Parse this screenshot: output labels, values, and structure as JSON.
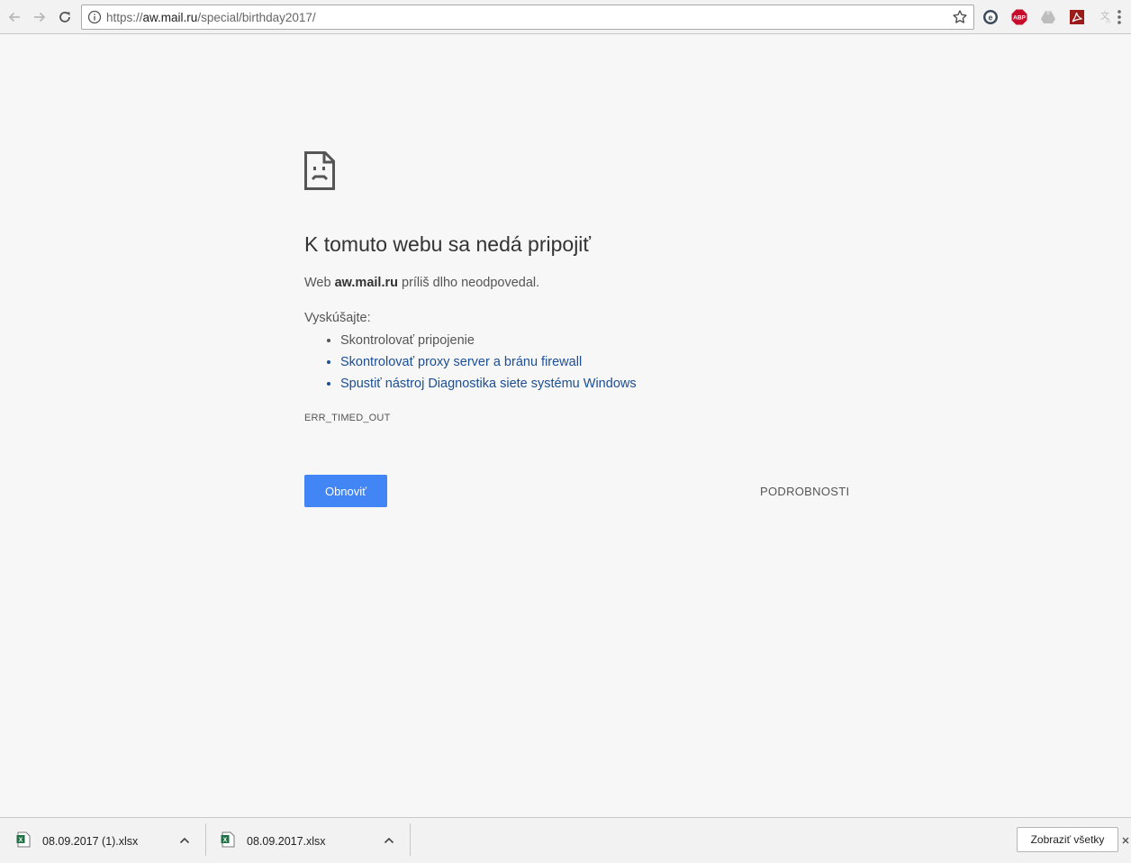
{
  "browser": {
    "url_scheme": "https://",
    "url_host": "aw.mail.ru",
    "url_path": "/special/birthday2017/",
    "icons": {
      "back": "arrow-left-icon",
      "forward": "arrow-right-icon",
      "reload": "reload-icon",
      "info": "info-icon",
      "bookmark": "star-icon"
    },
    "extensions": [
      {
        "name": "e-extension-icon"
      },
      {
        "name": "adblock-plus-icon",
        "label": "ABP"
      },
      {
        "name": "drive-icon"
      },
      {
        "name": "acrobat-icon"
      },
      {
        "name": "translate-icon"
      }
    ]
  },
  "error_page": {
    "title": "K tomuto webu sa nedá pripojiť",
    "desc_prefix": "Web ",
    "desc_host": "aw.mail.ru",
    "desc_suffix": " príliš dlho neodpovedal.",
    "try_label": "Vyskúšajte:",
    "suggestions": [
      {
        "text": "Skontrolovať pripojenie",
        "link": false
      },
      {
        "text": "Skontrolovať proxy server a bránu firewall",
        "link": true
      },
      {
        "text": "Spustiť nástroj Diagnostika siete systému Windows",
        "link": true
      }
    ],
    "error_code": "ERR_TIMED_OUT",
    "reload_label": "Obnoviť",
    "details_label": "PODROBNOSTI"
  },
  "downloads": {
    "items": [
      {
        "filename": "08.09.2017 (1).xlsx"
      },
      {
        "filename": "08.09.2017.xlsx"
      }
    ],
    "show_all_label": "Zobraziť všetky"
  },
  "colors": {
    "accent": "#4285f4",
    "link": "#1a4e96",
    "page_bg": "#f7f7f7"
  }
}
